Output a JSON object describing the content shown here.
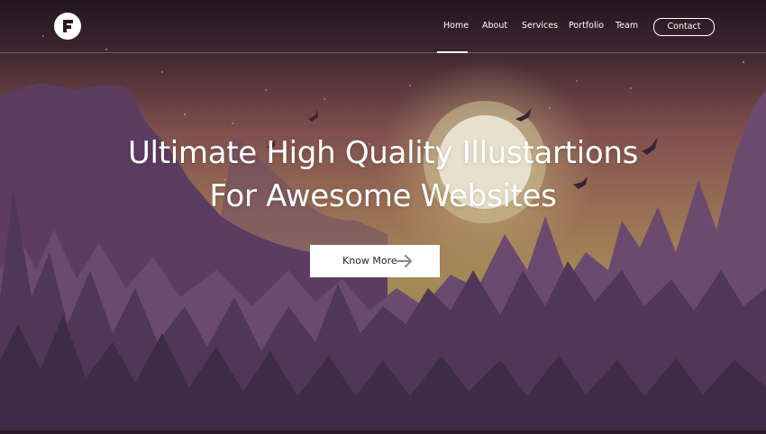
{
  "header": {
    "logo_icon": "brand-f-logo-icon",
    "nav": [
      {
        "label": "Home",
        "active": true
      },
      {
        "label": "About"
      },
      {
        "label": "Services"
      },
      {
        "label": "Portfolio"
      },
      {
        "label": "Team"
      }
    ],
    "contact_label": "Contact"
  },
  "hero": {
    "title_line1": "Ultimate High Quality Illustartions",
    "title_line2": "For Awesome Websites",
    "cta_label": "Know More",
    "cta_icon": "arrow-right-icon"
  },
  "colors": {
    "sky_top": "#2b1a22",
    "sky_mid": "#8a5650",
    "sky_glow": "#b09a5c",
    "mountain": "#5c3d60",
    "forest_far": "#6b4a72",
    "forest_mid": "#4f3654",
    "forest_near": "#3c2a44",
    "moon": "#e8e2cf"
  }
}
